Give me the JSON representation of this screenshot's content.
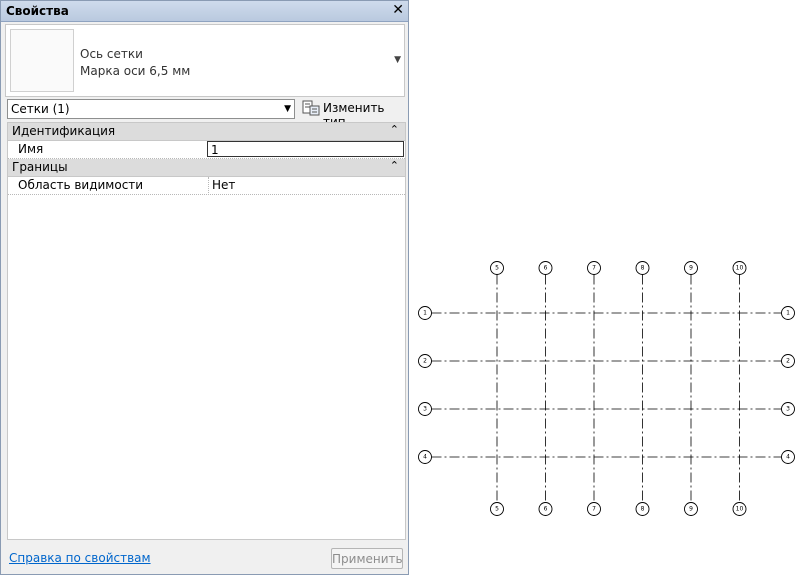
{
  "window": {
    "title": "Свойства",
    "close_glyph": "✕"
  },
  "type_selector": {
    "family": "Ось сетки",
    "type": "Марка оси 6,5 мм"
  },
  "instance_filter": {
    "value": "Сетки (1)"
  },
  "edit_type": {
    "label": "Изменить тип"
  },
  "categories": [
    {
      "label": "Идентификация",
      "collapse": "⌃",
      "properties": [
        {
          "name": "Имя",
          "value": "1",
          "editing": true
        }
      ]
    },
    {
      "label": "Границы",
      "collapse": "⌃",
      "properties": [
        {
          "name": "Область видимости",
          "value": "Нет"
        }
      ]
    }
  ],
  "footer": {
    "help_link": "Справка по свойствам",
    "apply_label": "Применить"
  },
  "drawing": {
    "horizontal_grids": [
      "1",
      "2",
      "3",
      "4"
    ],
    "vertical_grids": [
      "5",
      "6",
      "7",
      "8",
      "9",
      "10"
    ]
  }
}
